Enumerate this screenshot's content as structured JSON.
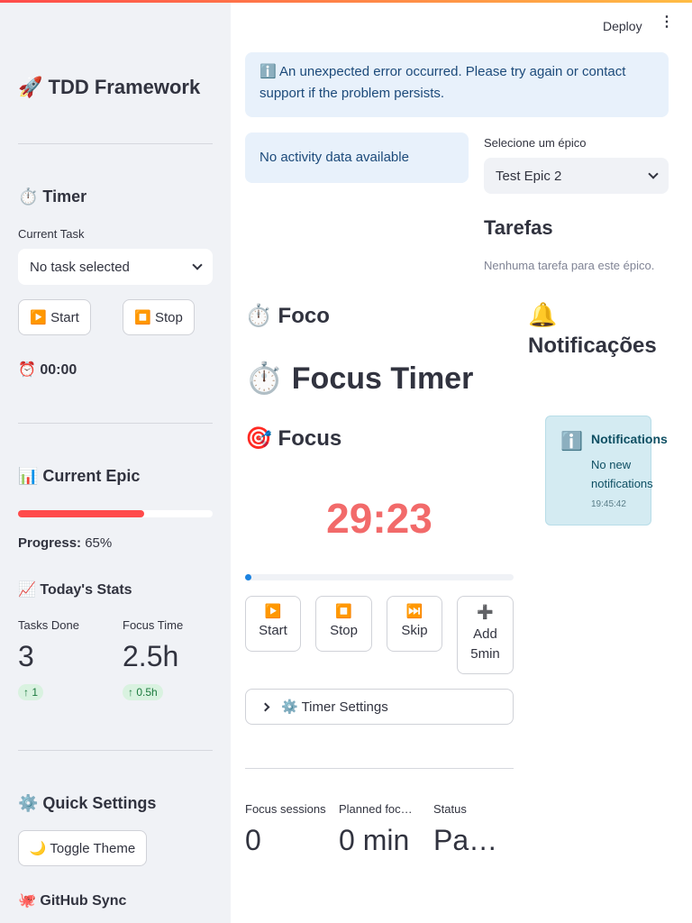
{
  "toolbar": {
    "deploy_label": "Deploy"
  },
  "sidebar": {
    "app_title": "🚀 TDD Framework",
    "timer_heading": "⏱️ Timer",
    "current_task_label": "Current Task",
    "current_task_value": "No task selected",
    "start_label": "▶️ Start",
    "stop_label": "⏹️ Stop",
    "elapsed": "⏰ 00:00",
    "epic_heading": "📊 Current Epic",
    "progress_value": 0.65,
    "progress_label": "Progress:",
    "progress_text": "65%",
    "stats_heading": "📈 Today's Stats",
    "tasks_done_label": "Tasks Done",
    "tasks_done_value": "3",
    "tasks_done_delta": "1",
    "focus_time_label": "Focus Time",
    "focus_time_value": "2.5h",
    "focus_time_delta": "0.5h",
    "settings_heading": "⚙️ Quick Settings",
    "toggle_theme_label": "🌙 Toggle Theme",
    "github_heading": "🐙 GitHub Sync"
  },
  "main": {
    "error_text": "ℹ️ An unexpected error occurred. Please try again or contact support if the problem persists.",
    "activity_text": "No activity data available",
    "epic_select_label": "Selecione um épico",
    "epic_select_value": "Test Epic 2",
    "tasks_heading": "Tarefas",
    "tasks_empty": "Nenhuma tarefa para este épico.",
    "foco_heading": "⏱️ Foco",
    "focus_timer_heading": "⏱️ Focus Timer",
    "focus_heading": "🎯 Focus",
    "timer_display": "29:23",
    "timer_progress": 0.01,
    "buttons": {
      "start": {
        "icon": "▶️",
        "label": "Start"
      },
      "stop": {
        "icon": "⏹️",
        "label": "Stop"
      },
      "skip": {
        "icon": "⏭️",
        "label": "Skip"
      },
      "add": {
        "icon": "➕",
        "label": "Add 5min"
      }
    },
    "timer_settings_label": "⚙️ Timer Settings",
    "metrics": [
      {
        "label": "Focus sessions",
        "value": "0"
      },
      {
        "label": "Planned foc…",
        "value": "0 min"
      },
      {
        "label": "Status",
        "value": "Pa…"
      }
    ]
  },
  "notifications": {
    "heading_icon": "🔔",
    "heading": "Notificações",
    "card_title": "Notifications",
    "card_body": "No new notifications",
    "card_time": "19:45:42"
  },
  "colors": {
    "accent": "#ff4b4b",
    "timer": "#f26a6a",
    "info_bg": "#e8f1fb",
    "notif_bg": "#d4ebf2"
  }
}
